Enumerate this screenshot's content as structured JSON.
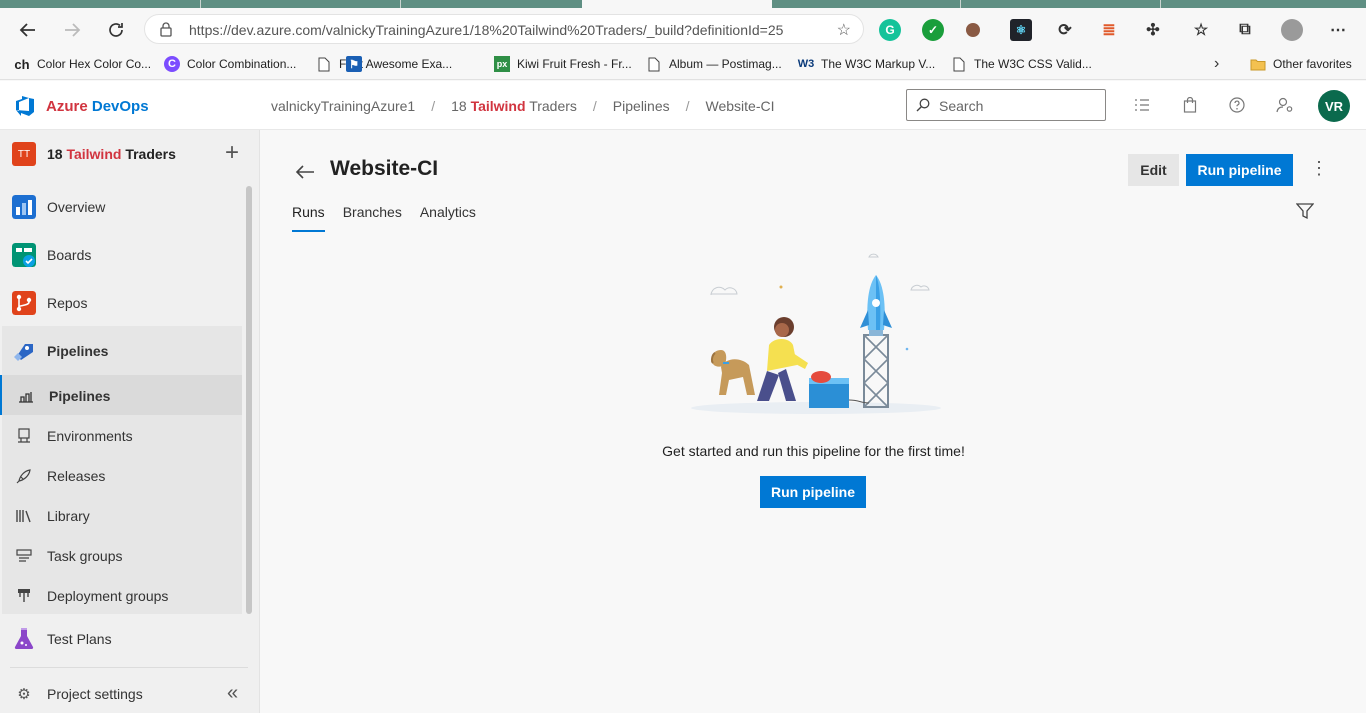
{
  "browser": {
    "url": "https://dev.azure.com/valnickyTrainingAzure1/18%20Tailwind%20Traders/_build?definitionId=25",
    "favorites": [
      {
        "icon": "ch",
        "label": "Color Hex Color Co..."
      },
      {
        "icon": "C",
        "label": "Color Combination..."
      },
      {
        "icon": "",
        "label": "Font Awesome Exa..."
      },
      {
        "icon": "px",
        "label": "Kiwi Fruit Fresh - Fr..."
      },
      {
        "icon": "",
        "label": "Album — Postimag..."
      },
      {
        "icon": "W3",
        "label": "The W3C Markup V..."
      },
      {
        "icon": "",
        "label": "The W3C CSS Valid..."
      }
    ],
    "other_favorites": "Other favorites"
  },
  "header": {
    "brand_part1": "Azure",
    "brand_part2": "DevOps",
    "crumb_org": "valnickyTrainingAzure1",
    "crumb_project_num": "18",
    "crumb_project_red": "Tailwind",
    "crumb_project_rest": "Traders",
    "crumb_pipelines": "Pipelines",
    "crumb_pipeline": "Website-CI",
    "search_placeholder": "Search",
    "avatar_initials": "VR"
  },
  "sidebar": {
    "project_icon": "TT",
    "project_num": "18",
    "project_red": "Tailwind",
    "project_rest": "Traders",
    "items": [
      {
        "label": "Overview"
      },
      {
        "label": "Boards"
      },
      {
        "label": "Repos"
      },
      {
        "label": "Pipelines"
      }
    ],
    "sub_items": [
      {
        "label": "Pipelines"
      },
      {
        "label": "Environments"
      },
      {
        "label": "Releases"
      },
      {
        "label": "Library"
      },
      {
        "label": "Task groups"
      },
      {
        "label": "Deployment groups"
      }
    ],
    "test_plans": "Test Plans",
    "project_settings": "Project settings"
  },
  "main": {
    "title": "Website-CI",
    "edit_label": "Edit",
    "run_label": "Run pipeline",
    "tabs": [
      {
        "label": "Runs"
      },
      {
        "label": "Branches"
      },
      {
        "label": "Analytics"
      }
    ],
    "empty_message": "Get started and run this pipeline for the first time!",
    "empty_run_label": "Run pipeline"
  },
  "colors": {
    "accent": "#0078d4",
    "brand_red": "#d1343f",
    "avatar": "#0b6a4d"
  }
}
